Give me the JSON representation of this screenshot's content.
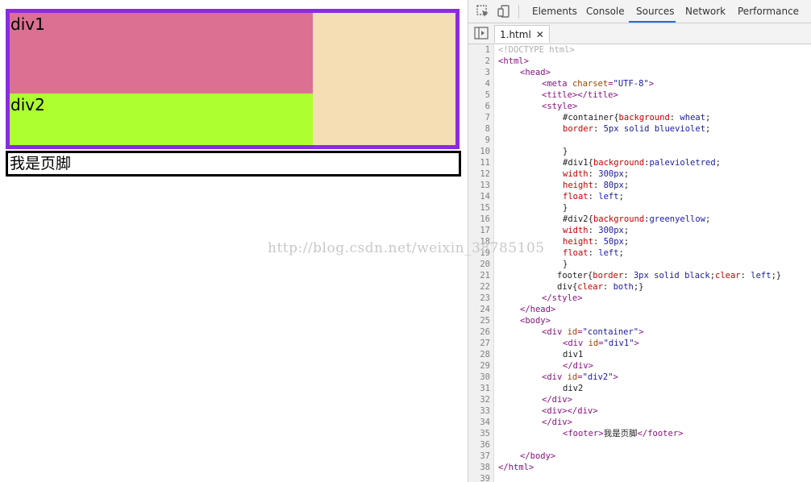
{
  "page": {
    "div1_text": "div1",
    "div2_text": "div2",
    "footer_text": "我是页脚",
    "watermark": "http://blog.csdn.net/weixin_38785105",
    "colors": {
      "container_bg": "#f5deb3",
      "container_border": "#8a2be2",
      "div1_bg": "#db7093",
      "div2_bg": "#adff2f"
    }
  },
  "devtools": {
    "tabs": [
      "Elements",
      "Console",
      "Sources",
      "Network",
      "Performance"
    ],
    "active_tab": "Sources",
    "open_file": "1.html",
    "lines": [
      "1",
      "2",
      "3",
      "4",
      "5",
      "6",
      "7",
      "8",
      "9",
      "10",
      "11",
      "12",
      "13",
      "14",
      "15",
      "16",
      "17",
      "18",
      "19",
      "20",
      "21",
      "22",
      "23",
      "24",
      "25",
      "26",
      "27",
      "28",
      "29",
      "30",
      "31",
      "32",
      "33",
      "34",
      "35",
      "36",
      "37",
      "38",
      "39"
    ],
    "code": {
      "l1": "<!DOCTYPE html>",
      "html_open": "<html>",
      "head_open": "<head>",
      "meta": "<meta ",
      "meta_attr": "charset",
      "meta_val": "\"UTF-8\"",
      "meta_close": ">",
      "title": "<title></title>",
      "style_open": "<style>",
      "l7a": "#container{",
      "l7b": "background",
      "l7c": ": ",
      "l7d": "wheat",
      "l7e": ";",
      "l8a": "border",
      "l8b": ": ",
      "l8c": "5px solid blueviolet",
      "l8d": ";",
      "l10": "}",
      "l11a": "#div1{",
      "l11b": "background",
      "l11c": ":",
      "l11d": "palevioletred",
      "l11e": ";",
      "l12a": "width",
      "l12b": ": ",
      "l12c": "300px",
      "l12d": ";",
      "l13a": "height",
      "l13b": ": ",
      "l13c": "80px",
      "l13d": ";",
      "l14a": "float",
      "l14b": ": ",
      "l14c": "left",
      "l14d": ";",
      "l15": "}",
      "l16a": "#div2{",
      "l16b": "background",
      "l16c": ":",
      "l16d": "greenyellow",
      "l16e": ";",
      "l17a": "width",
      "l17b": ": ",
      "l17c": "300px",
      "l17d": ";",
      "l18a": "height",
      "l18b": ": ",
      "l18c": "50px",
      "l18d": ";",
      "l19a": "float",
      "l19b": ": ",
      "l19c": "left",
      "l19d": ";",
      "l20": "}",
      "l21a": "footer{",
      "l21b": "border",
      "l21c": ": ",
      "l21d": "3px solid black",
      "l21e": ";",
      "l21f": "clear",
      "l21g": ": ",
      "l21h": "left",
      "l21i": ";}",
      "l22a": "div{",
      "l22b": "clear",
      "l22c": ": ",
      "l22d": "both",
      "l22e": ";}",
      "style_close": "</style>",
      "head_close": "</head>",
      "body_open": "<body>",
      "l26a": "<div ",
      "l26b": "id",
      "l26c": "=",
      "l26d": "\"container\"",
      "l26e": ">",
      "l27a": "<div ",
      "l27b": "id",
      "l27c": "=",
      "l27d": "\"div1\"",
      "l27e": ">",
      "l28": "div1",
      "l29": "</div>",
      "l30a": "<div ",
      "l30b": "id",
      "l30c": "=",
      "l30d": "\"div2\"",
      "l30e": ">",
      "l31": "div2",
      "l32": "</div>",
      "l33": "<div></div>",
      "l34": "</div>",
      "l35a": "<footer>",
      "l35b": "我是页脚",
      "l35c": "</footer>",
      "body_close": "</body>",
      "html_close": "</html>"
    }
  }
}
